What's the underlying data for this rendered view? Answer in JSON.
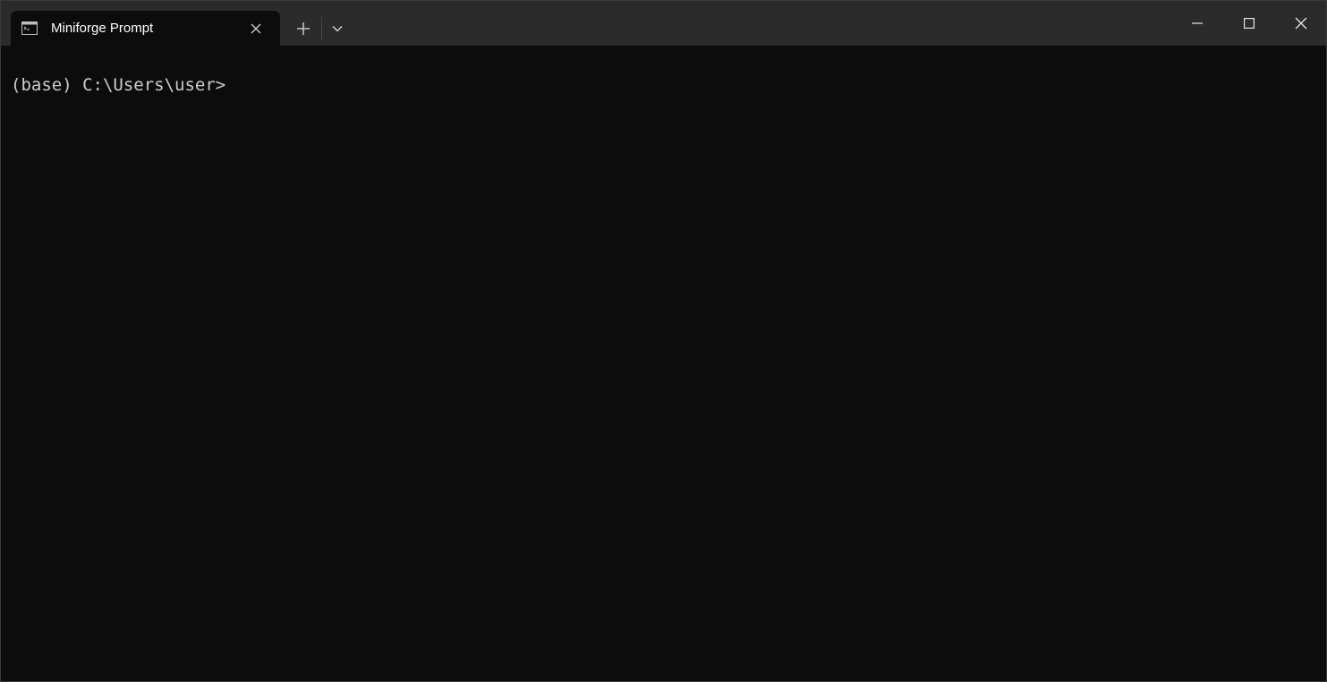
{
  "window": {
    "colors": {
      "titlebar": "#2b2b2b",
      "terminal_bg": "#0c0c0c",
      "text": "#cccccc"
    }
  },
  "tab": {
    "title": "Miniforge Prompt",
    "icon": "terminal-icon",
    "close_icon": "close-icon"
  },
  "tabbar": {
    "new_tab_icon": "plus-icon",
    "dropdown_icon": "chevron-down-icon"
  },
  "caption": {
    "minimize_icon": "minimize-icon",
    "maximize_icon": "maximize-icon",
    "close_icon": "close-icon"
  },
  "terminal": {
    "prompt": "(base) C:\\Users\\user>"
  }
}
